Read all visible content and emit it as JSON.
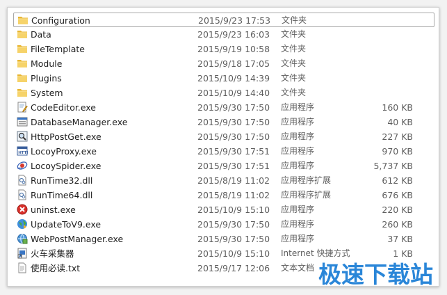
{
  "files": [
    {
      "name": "Configuration",
      "date": "2015/9/23 17:53",
      "type": "文件夹",
      "size": "",
      "icon": "folder-icon",
      "selected": true
    },
    {
      "name": "Data",
      "date": "2015/9/23 16:03",
      "type": "文件夹",
      "size": "",
      "icon": "folder-icon"
    },
    {
      "name": "FileTemplate",
      "date": "2015/9/19 10:58",
      "type": "文件夹",
      "size": "",
      "icon": "folder-icon"
    },
    {
      "name": "Module",
      "date": "2015/9/18 17:05",
      "type": "文件夹",
      "size": "",
      "icon": "folder-icon"
    },
    {
      "name": "Plugins",
      "date": "2015/10/9 14:39",
      "type": "文件夹",
      "size": "",
      "icon": "folder-icon"
    },
    {
      "name": "System",
      "date": "2015/10/9 14:40",
      "type": "文件夹",
      "size": "",
      "icon": "folder-icon"
    },
    {
      "name": "CodeEditor.exe",
      "date": "2015/9/30 17:50",
      "type": "应用程序",
      "size": "160 KB",
      "icon": "code-editor-icon"
    },
    {
      "name": "DatabaseManager.exe",
      "date": "2015/9/30 17:50",
      "type": "应用程序",
      "size": "40 KB",
      "icon": "database-icon"
    },
    {
      "name": "HttpPostGet.exe",
      "date": "2015/9/30 17:50",
      "type": "应用程序",
      "size": "227 KB",
      "icon": "magnifier-icon"
    },
    {
      "name": "LocoyProxy.exe",
      "date": "2015/9/30 17:51",
      "type": "应用程序",
      "size": "970 KB",
      "icon": "http-proxy-icon"
    },
    {
      "name": "LocoySpider.exe",
      "date": "2015/9/30 17:51",
      "type": "应用程序",
      "size": "5,737 KB",
      "icon": "spider-icon"
    },
    {
      "name": "RunTime32.dll",
      "date": "2015/8/19 11:02",
      "type": "应用程序扩展",
      "size": "612 KB",
      "icon": "dll-file-icon"
    },
    {
      "name": "RunTime64.dll",
      "date": "2015/8/19 11:02",
      "type": "应用程序扩展",
      "size": "676 KB",
      "icon": "dll-file-icon"
    },
    {
      "name": "uninst.exe",
      "date": "2015/10/9 15:10",
      "type": "应用程序",
      "size": "220 KB",
      "icon": "uninstall-icon"
    },
    {
      "name": "UpdateToV9.exe",
      "date": "2015/9/30 17:50",
      "type": "应用程序",
      "size": "260 KB",
      "icon": "update-globe-icon"
    },
    {
      "name": "WebPostManager.exe",
      "date": "2015/9/30 17:50",
      "type": "应用程序",
      "size": "37 KB",
      "icon": "web-post-icon"
    },
    {
      "name": "火车采集器",
      "date": "2015/10/9 15:10",
      "type": "Internet 快捷方式",
      "size": "1 KB",
      "icon": "shortcut-icon"
    },
    {
      "name": "使用必读.txt",
      "date": "2015/9/17 12:06",
      "type": "文本文档",
      "size": "",
      "icon": "text-file-icon"
    }
  ],
  "watermark": "极速下载站",
  "colors": {
    "folder": "#f1c84b",
    "watermark": "#2a86d8",
    "selected_border": "#a9a9a9"
  }
}
